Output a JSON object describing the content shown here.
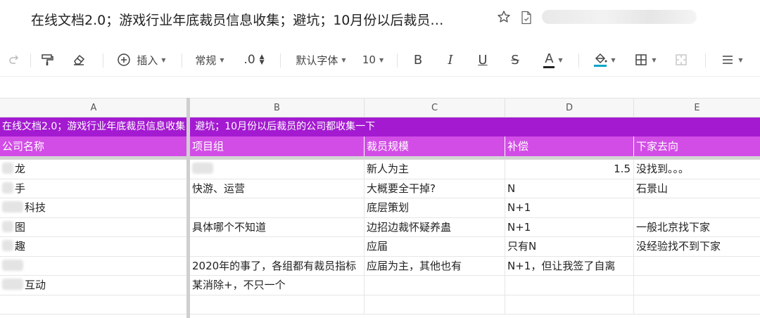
{
  "document": {
    "title": "在线文档2.0；游戏行业年底裁员信息收集；避坑；10月份以后裁员…"
  },
  "toolbar": {
    "insert_label": "插入",
    "format_label": "常规",
    "decimal_label": ".0",
    "font_label": "默认字体",
    "size_label": "10",
    "bold": "B",
    "italic": "I",
    "underline": "U",
    "strike": "S",
    "font_color_letter": "A",
    "accent_colors": {
      "font_underline": "#222222",
      "fill_underline": "#0ea5c7"
    }
  },
  "grid": {
    "columns": [
      "A",
      "B",
      "C",
      "D",
      "E"
    ],
    "banner": "在线文档2.0；游戏行业年底裁员信息收集；避坑；10月份以后裁员的公司都收集一下",
    "banner_color": "#a41ad1",
    "header_color": "#d24de6",
    "headers": [
      "公司名称",
      "项目组",
      "裁员规模",
      "补偿",
      "下家去向"
    ],
    "rows": [
      {
        "a": "龙",
        "b": "",
        "c": "新人为主",
        "d": "1.5",
        "e": "没找到。。。"
      },
      {
        "a": "手",
        "b": "快游、运营",
        "c": "大概要全干掉?",
        "d": "N",
        "e": "石景山"
      },
      {
        "a": "科技",
        "b": "",
        "c": "底层策划",
        "d": "N+1",
        "e": ""
      },
      {
        "a": "图",
        "b": "具体哪个不知道",
        "c": "边招边裁怀疑养蛊",
        "d": "N+1",
        "e": "一般北京找下家"
      },
      {
        "a": "趣",
        "b": "",
        "c": "应届",
        "d": "只有N",
        "e": "没经验找不到下家"
      },
      {
        "a": "",
        "b": "2020年的事了，各组都有裁员指标",
        "c": "应届为主，其他也有",
        "d": "N+1，但让我签了自离",
        "e": ""
      },
      {
        "a": "互动",
        "b": "某消除+，不只一个",
        "c": "",
        "d": "",
        "e": ""
      },
      {
        "a": "",
        "b": "",
        "c": "",
        "d": "",
        "e": ""
      }
    ]
  }
}
